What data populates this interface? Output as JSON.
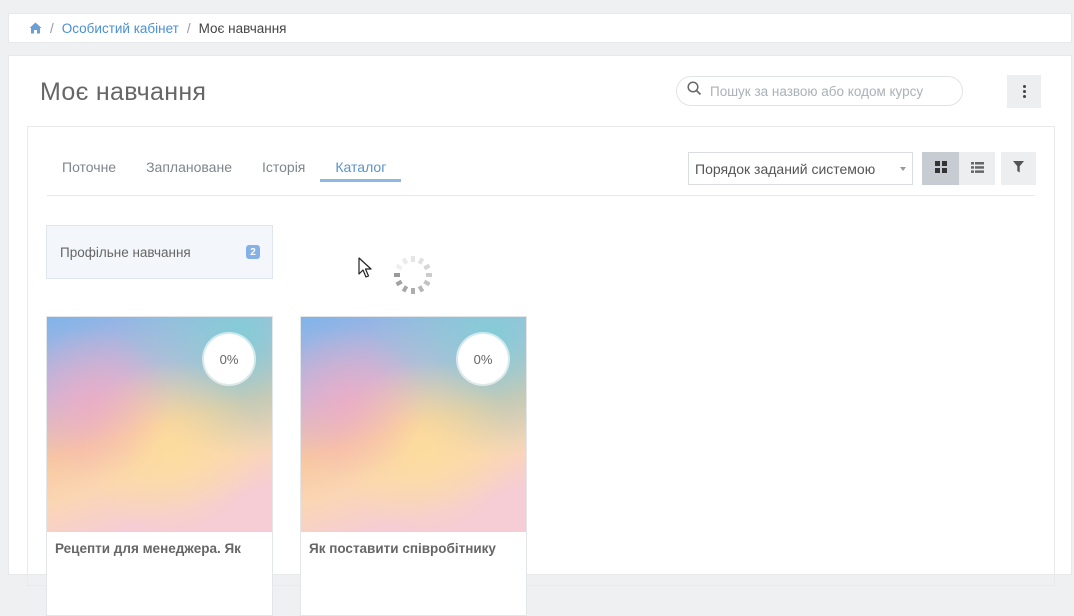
{
  "breadcrumb": {
    "home_icon": "home-icon",
    "items": [
      "Особистий кабінет",
      "Моє навчання"
    ]
  },
  "header": {
    "title": "Моє навчання",
    "search_placeholder": "Пошук за назвою або кодом курсу",
    "menu_icon": "kebab-icon"
  },
  "tabs": [
    "Поточне",
    "Заплановане",
    "Історія",
    "Каталог"
  ],
  "active_tab": "Каталог",
  "sort": {
    "selected": "Порядок заданий системою"
  },
  "view_buttons": [
    "grid-view-icon",
    "list-view-icon",
    "filter-icon"
  ],
  "category": {
    "label": "Профільне навчання",
    "count": "2"
  },
  "courses": [
    {
      "title": "Рецепти для менеджера. Як",
      "progress": "0%"
    },
    {
      "title": "Як поставити співробітнику",
      "progress": "0%"
    }
  ],
  "colors": {
    "accent": "#5b93c9",
    "badge": "#86b1e6"
  }
}
